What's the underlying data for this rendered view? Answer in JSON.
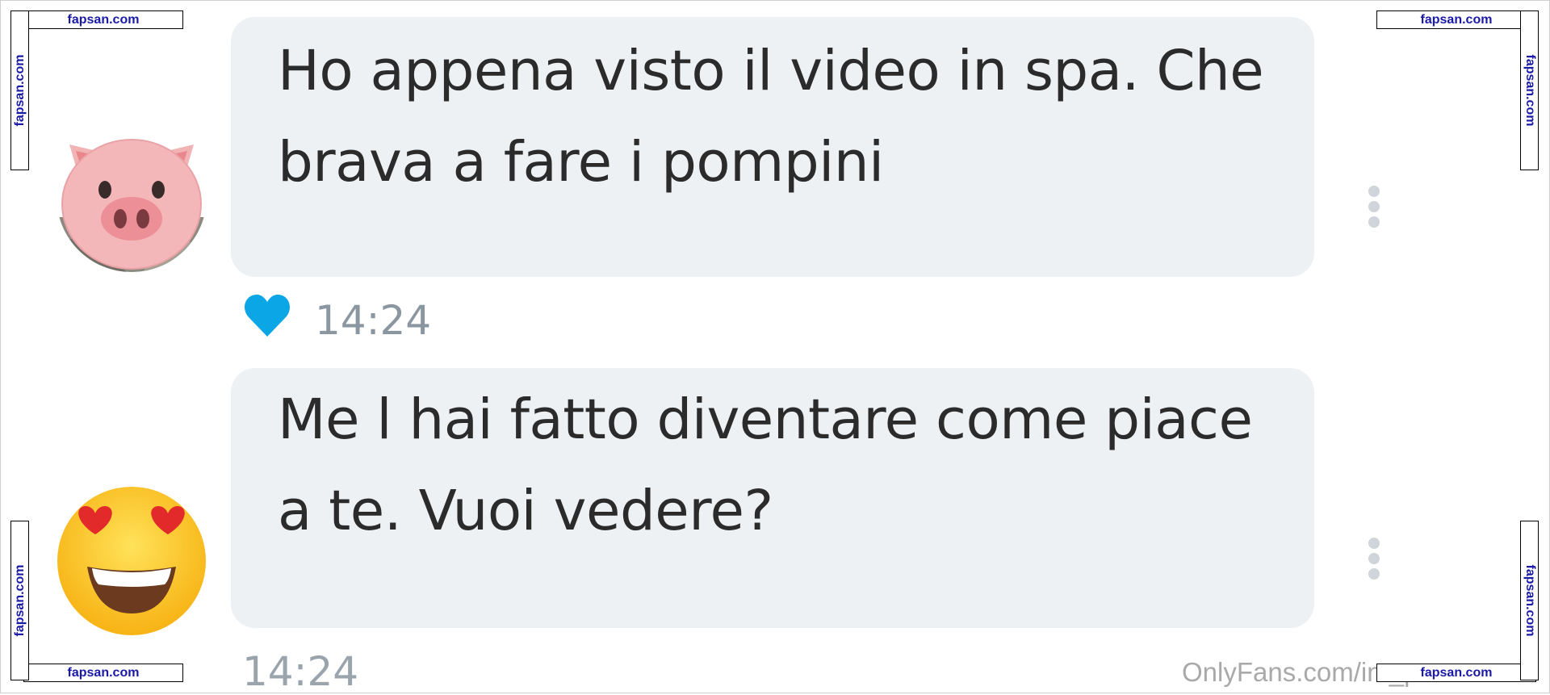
{
  "conversation": {
    "messages": [
      {
        "avatar": "pig-face-emoji",
        "text": "Ho appena visto il video in spa. Che brava a fare i pompini",
        "liked": true,
        "time": "14:24"
      },
      {
        "avatar": "smiling-face-with-heart-eyes-emoji",
        "text": "Me l hai fatto diventare come piace a te. Vuoi vedere?",
        "liked": false,
        "time": "14:24"
      }
    ]
  },
  "colors": {
    "bubble_bg": "#eef1f3",
    "like_heart": "#0aa6e6",
    "timestamp": "#8a96a0",
    "badge_text": "#1a1aa8"
  },
  "watermark": {
    "text": "OnlyFans.com/in    _p    n"
  },
  "badges": {
    "label": "fapsan.com"
  }
}
